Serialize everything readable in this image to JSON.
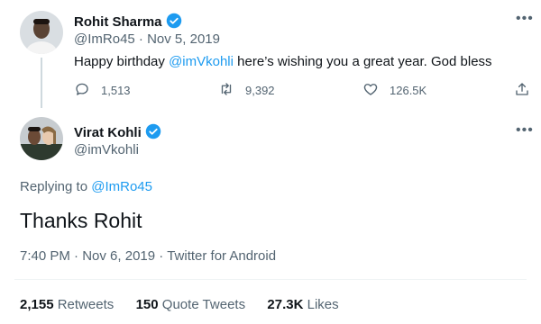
{
  "parent_tweet": {
    "name": "Rohit Sharma",
    "handle": "@ImRo45",
    "separator": "·",
    "date": "Nov 5, 2019",
    "text_before": "Happy birthday ",
    "mention": "@imVkohli",
    "text_after": " here’s wishing you a great year. God bless",
    "replies": "1,513",
    "retweets": "9,392",
    "likes": "126.5K"
  },
  "main_tweet": {
    "name": "Virat Kohli",
    "handle": "@imVkohli",
    "replying_prefix": "Replying to ",
    "replying_handle": "@ImRo45",
    "text": "Thanks Rohit",
    "time": "7:40 PM",
    "date": "Nov 6, 2019",
    "source": "Twitter for Android",
    "separator": "·"
  },
  "stats": {
    "retweets_count": "2,155",
    "retweets_label": "Retweets",
    "quote_count": "150",
    "quote_label": "Quote Tweets",
    "likes_count": "27.3K",
    "likes_label": "Likes"
  },
  "icons": {
    "reply": "reply-icon",
    "retweet": "retweet-icon",
    "like": "heart-icon",
    "share": "share-icon",
    "verified": "verified-badge-icon",
    "more": "more-icon"
  },
  "colors": {
    "accent": "#1d9bf0",
    "secondary_text": "#536471",
    "primary_text": "#0f1419"
  }
}
